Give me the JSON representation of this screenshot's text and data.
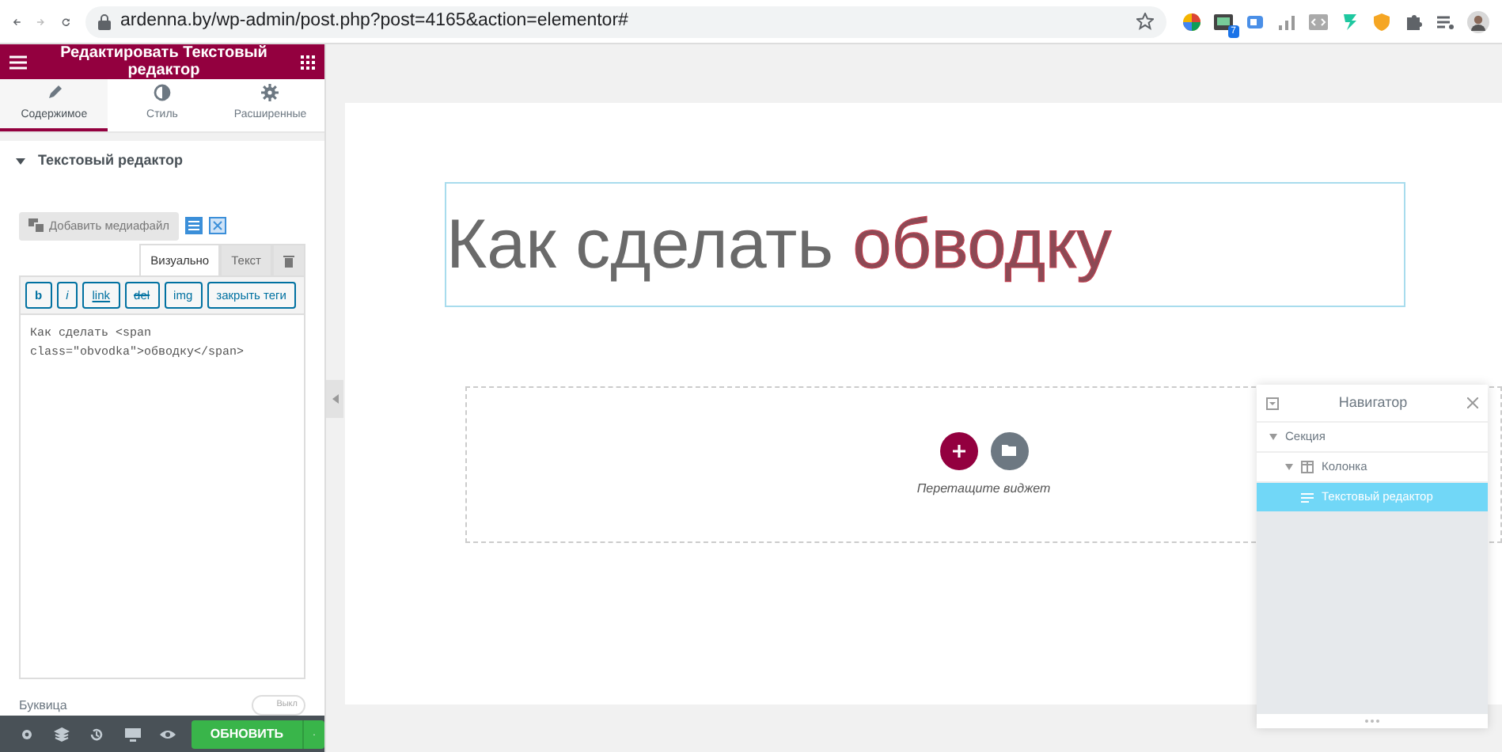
{
  "browser": {
    "url": "ardenna.by/wp-admin/post.php?post=4165&action=elementor#",
    "extension_badge": "7"
  },
  "panel": {
    "title": "Редактировать Текстовый редактор",
    "tabs": [
      {
        "label": "Содержимое",
        "selected": true
      },
      {
        "label": "Стиль",
        "selected": false
      },
      {
        "label": "Расширенные",
        "selected": false
      }
    ],
    "section": {
      "title": "Текстовый редактор",
      "expanded": true
    },
    "media_button": "Добавить медиафайл",
    "editor_tabs": [
      {
        "label": "Визуально",
        "selected": true
      },
      {
        "label": "Текст",
        "selected": false
      }
    ],
    "quicktags": [
      "b",
      "i",
      "link",
      "del",
      "img",
      "закрыть теги"
    ],
    "code": "Как сделать <span class=\"obvodka\">обводку</span>",
    "dropcap": {
      "label": "Буквица",
      "on": false,
      "toggle_text": "Выкл"
    },
    "update_button": "ОБНОВИТЬ"
  },
  "canvas": {
    "heading": {
      "text": "Как сделать",
      "highlight": "обводку"
    },
    "drop_hint": "Перетащите виджет"
  },
  "navigator": {
    "title": "Навигатор",
    "tree": [
      {
        "label": "Секция",
        "expanded": true,
        "selected": false,
        "children": [
          {
            "label": "Колонка",
            "expanded": true,
            "selected": false,
            "children": [
              {
                "label": "Текстовый редактор",
                "selected": true
              }
            ]
          }
        ]
      }
    ]
  }
}
